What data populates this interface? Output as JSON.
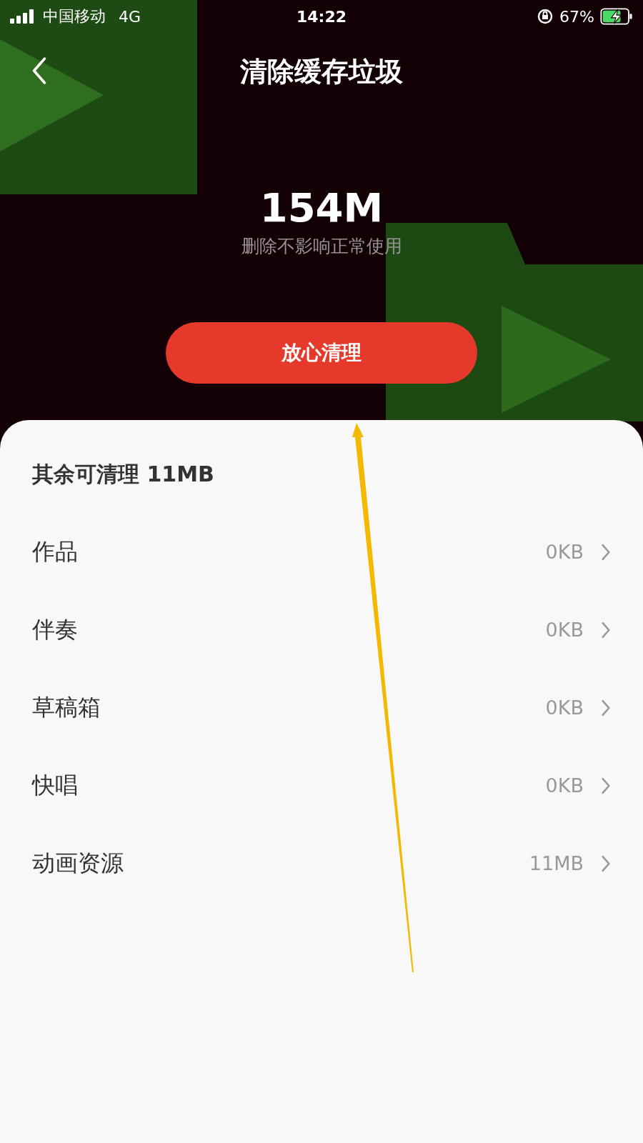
{
  "status_bar": {
    "carrier": "中国移动",
    "network": "4G",
    "time": "14:22",
    "battery": "67%"
  },
  "header": {
    "title": "清除缓存垃圾"
  },
  "summary": {
    "size": "154M",
    "note": "删除不影响正常使用"
  },
  "clean_button": {
    "label": "放心清理"
  },
  "other": {
    "title": "其余可清理 11MB",
    "items": [
      {
        "label": "作品",
        "value": "0KB"
      },
      {
        "label": "伴奏",
        "value": "0KB"
      },
      {
        "label": "草稿箱",
        "value": "0KB"
      },
      {
        "label": "快唱",
        "value": "0KB"
      },
      {
        "label": "动画资源",
        "value": "11MB"
      }
    ]
  }
}
